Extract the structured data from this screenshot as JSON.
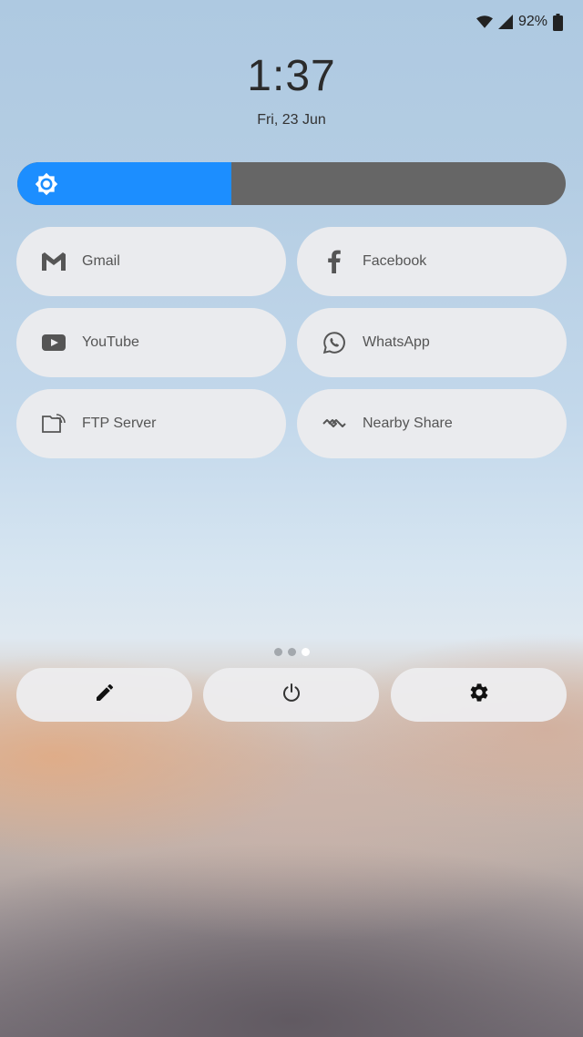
{
  "status_bar": {
    "battery_text": "92%",
    "icons": [
      "wifi-icon",
      "cellular-signal-icon",
      "battery-icon"
    ]
  },
  "clock": {
    "time": "1:37",
    "date": "Fri, 23 Jun"
  },
  "brightness": {
    "level": 0.39,
    "accent_color": "#1c8eff",
    "icon": "brightness-icon"
  },
  "shortcuts": [
    {
      "label": "Gmail",
      "icon": "gmail-icon"
    },
    {
      "label": "Facebook",
      "icon": "facebook-icon"
    },
    {
      "label": "YouTube",
      "icon": "youtube-icon"
    },
    {
      "label": "WhatsApp",
      "icon": "whatsapp-icon"
    },
    {
      "label": "FTP Server",
      "icon": "ftp-folder-icon"
    },
    {
      "label": "Nearby Share",
      "icon": "nearby-share-icon"
    }
  ],
  "pager": {
    "page_count": 3,
    "current_page": 3
  },
  "bottom_actions": [
    {
      "icon": "edit-pencil-icon"
    },
    {
      "icon": "power-icon"
    },
    {
      "icon": "settings-gear-icon"
    }
  ]
}
